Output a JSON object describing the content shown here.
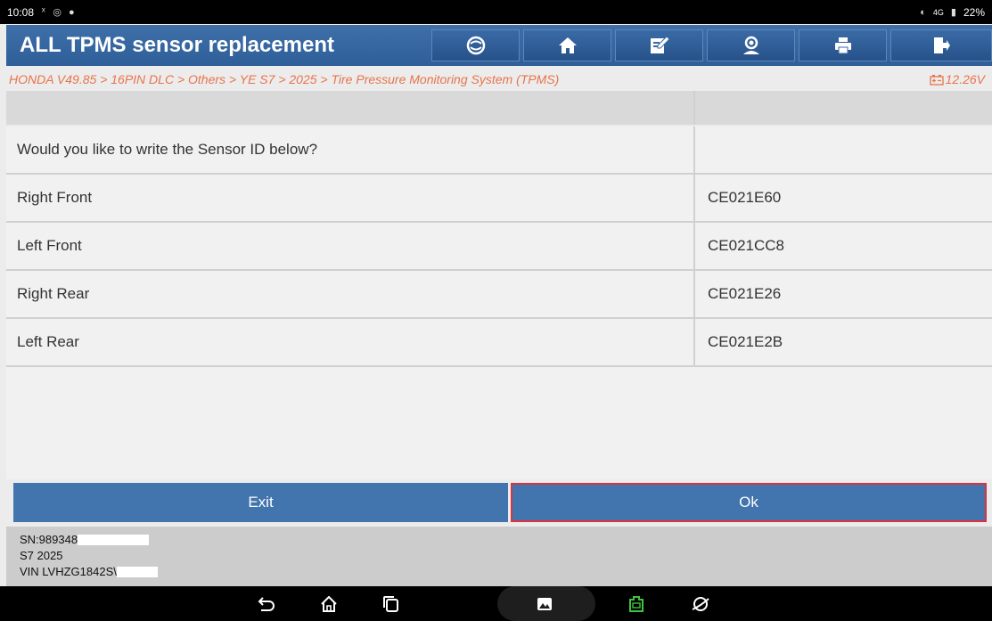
{
  "status_bar": {
    "time": "10:08",
    "network": "4G",
    "battery": "22%"
  },
  "header": {
    "title": "ALL TPMS sensor replacement",
    "buttons": [
      "tpms-icon",
      "home-icon",
      "edit-icon",
      "user-icon",
      "print-icon",
      "exit-icon"
    ]
  },
  "breadcrumb": {
    "path": "HONDA V49.85 > 16PIN DLC > Others > YE S7 > 2025 > Tire Pressure Monitoring System (TPMS)",
    "voltage": "12.26V"
  },
  "table": {
    "prompt": "Would you like to write the Sensor ID below?",
    "rows": [
      {
        "label": "Right Front",
        "value": "CE021E60"
      },
      {
        "label": "Left Front",
        "value": "CE021CC8"
      },
      {
        "label": "Right Rear",
        "value": "CE021E26"
      },
      {
        "label": "Left Rear",
        "value": "CE021E2B"
      }
    ]
  },
  "actions": {
    "exit": "Exit",
    "ok": "Ok"
  },
  "info": {
    "sn": "SN:989348",
    "model": "S7 2025",
    "vin": "VIN LVHZG1842S\\"
  },
  "colors": {
    "header_blue": "#3a6aa5",
    "button_blue": "#4274ad",
    "breadcrumb_orange": "#e8734b",
    "selected_border": "#d9333f",
    "vci_green": "#3cc43c"
  }
}
